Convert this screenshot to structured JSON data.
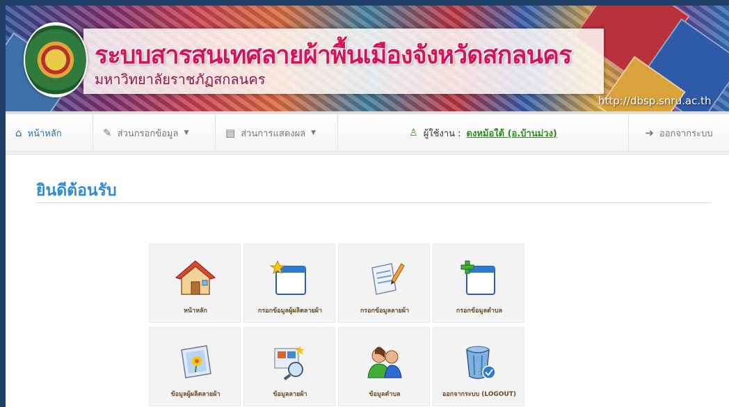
{
  "banner": {
    "title": "ระบบสารสนเทศลายผ้าพื้นเมืองจังหวัดสกลนคร",
    "subtitle": "มหาวิทยาลัยราชภัฏสกลนคร",
    "url": "http://dbsp.snru.ac.th"
  },
  "navbar": {
    "home_label": "หน้าหลัก",
    "input_label": "ส่วนกรอกข้อมูล",
    "display_label": "ส่วนการแสดงผล",
    "user_prefix": "ผู้ใช้งาน :",
    "user_name": "ดงหม้อใต้ (อ.บ้านม่วง)",
    "logout_label": "ออกจากระบบ"
  },
  "page": {
    "welcome": "ยินดีต้อนรับ"
  },
  "tiles": [
    {
      "label": "หน้าหลัก",
      "icon": "house-icon"
    },
    {
      "label": "กรอกข้อมูลผู้ผลิตลายผ้า",
      "icon": "new-window-star-icon"
    },
    {
      "label": "กรอกข้อมูลลายผ้า",
      "icon": "document-pencil-icon"
    },
    {
      "label": "กรอกข้อมูลตำบล",
      "icon": "add-window-icon"
    },
    {
      "label": "ข้อมูลผู้ผลิตลายผ้า",
      "icon": "picture-flower-icon"
    },
    {
      "label": "ข้อมูลลายผ้า",
      "icon": "image-search-icon"
    },
    {
      "label": "ข้อมูลตำบล",
      "icon": "users-icon"
    },
    {
      "label": "ออกจากระบบ (LOGOUT)",
      "icon": "trash-bin-icon"
    }
  ]
}
